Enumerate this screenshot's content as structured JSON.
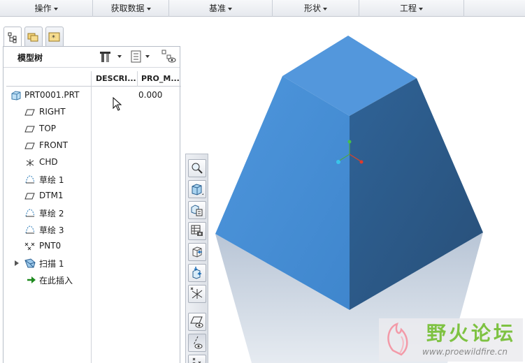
{
  "menubar": {
    "items": [
      {
        "label": "操作"
      },
      {
        "label": "获取数据"
      },
      {
        "label": "基准"
      },
      {
        "label": "形状"
      },
      {
        "label": "工程"
      }
    ]
  },
  "model_tree": {
    "title": "模型树",
    "columns": [
      "DESCRI...",
      "PRO_M..."
    ],
    "root": {
      "label": "PRT0001.PRT",
      "pro_m": "0.000"
    },
    "items": [
      {
        "label": "RIGHT",
        "icon": "datum-plane-icon"
      },
      {
        "label": "TOP",
        "icon": "datum-plane-icon"
      },
      {
        "label": "FRONT",
        "icon": "datum-plane-icon"
      },
      {
        "label": "CHD",
        "icon": "coordinate-system-icon"
      },
      {
        "label": "草绘 1",
        "icon": "sketch-icon"
      },
      {
        "label": "DTM1",
        "icon": "datum-plane-icon"
      },
      {
        "label": "草绘 2",
        "icon": "sketch-icon"
      },
      {
        "label": "草绘 3",
        "icon": "sketch-icon"
      },
      {
        "label": "PNT0",
        "icon": "datum-point-icon"
      },
      {
        "label": "扫描 1",
        "icon": "sweep-icon"
      },
      {
        "label": "在此插入",
        "icon": "insert-here-arrow-icon"
      }
    ]
  },
  "toolbar_icons": [
    "zoom-window-icon",
    "shaded-view-icon",
    "saved-views-icon",
    "view-manager-icon",
    "reorient-icon",
    "spin-center-icon",
    "coordinate-system-display-icon",
    "plane-display-icon",
    "axis-display-icon",
    "point-display-icon"
  ],
  "watermark": {
    "text": "野火论坛",
    "url": "www.proewildfire.cn"
  },
  "colors": {
    "part_face_light": "#4a90d6",
    "part_face_dark": "#2c5f8f",
    "part_top": "#5397dc",
    "accent_green": "#7ec242"
  }
}
